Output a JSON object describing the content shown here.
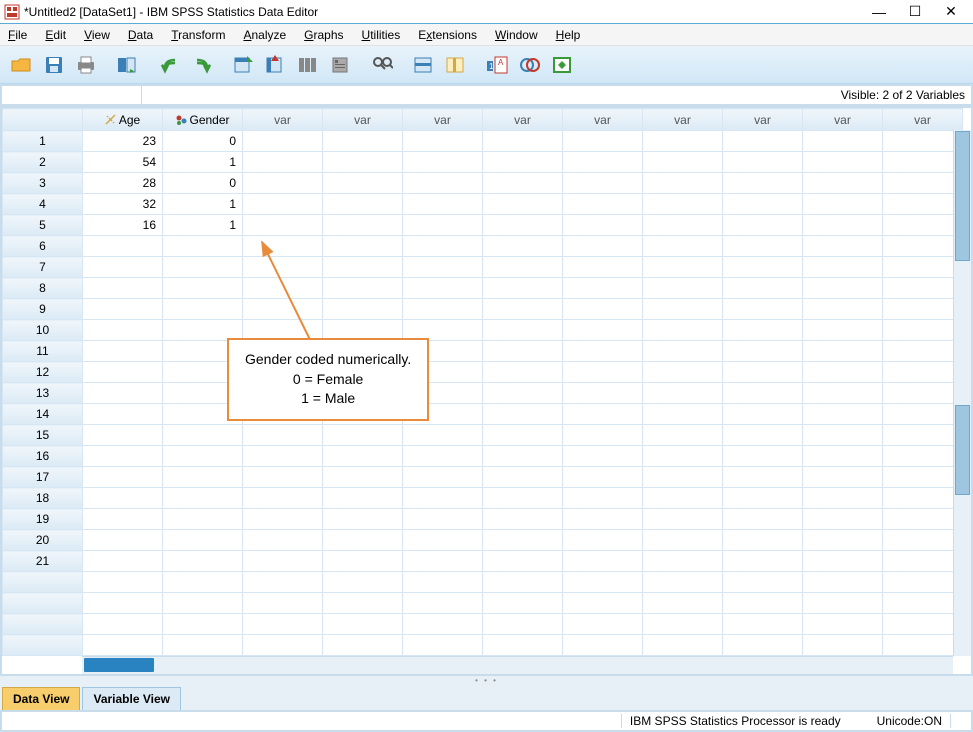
{
  "window": {
    "title": "*Untitled2 [DataSet1] - IBM SPSS Statistics Data Editor"
  },
  "menu": {
    "file": "File",
    "edit": "Edit",
    "view": "View",
    "data": "Data",
    "transform": "Transform",
    "analyze": "Analyze",
    "graphs": "Graphs",
    "utilities": "Utilities",
    "extensions": "Extensions",
    "window": "Window",
    "help": "Help"
  },
  "info": {
    "visible": "Visible: 2 of 2 Variables"
  },
  "columns": {
    "named": [
      "Age",
      "Gender"
    ],
    "blank_label": "var"
  },
  "data": {
    "rows": [
      {
        "n": 1,
        "Age": "23",
        "Gender": "0"
      },
      {
        "n": 2,
        "Age": "54",
        "Gender": "1"
      },
      {
        "n": 3,
        "Age": "28",
        "Gender": "0"
      },
      {
        "n": 4,
        "Age": "32",
        "Gender": "1"
      },
      {
        "n": 5,
        "Age": "16",
        "Gender": "1"
      }
    ],
    "empty_rows": [
      6,
      7,
      8,
      9,
      10,
      11,
      12,
      13,
      14,
      15,
      16,
      17,
      18,
      19,
      20,
      21
    ]
  },
  "annotation": {
    "line1": "Gender coded numerically.",
    "line2": "0 = Female",
    "line3": "1 = Male"
  },
  "tabs": {
    "data_view": "Data View",
    "variable_view": "Variable View"
  },
  "status": {
    "processor": "IBM SPSS Statistics Processor is ready",
    "unicode": "Unicode:ON"
  }
}
